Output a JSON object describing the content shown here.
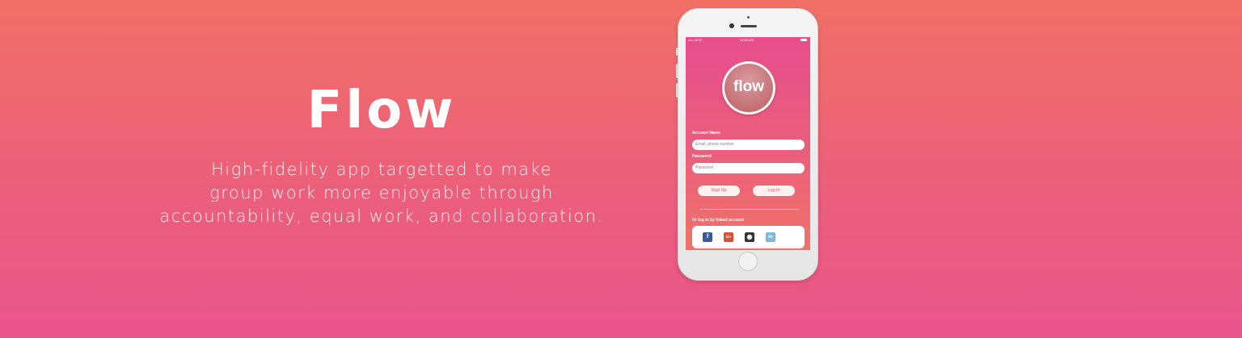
{
  "hero": {
    "title": "Flow",
    "description_lines": [
      "High-fidelity app targetted to make",
      "group work more enjoyable  through",
      "accountability, equal work, and collaboration."
    ]
  },
  "phone_screen": {
    "status_bar": {
      "carrier": "••••• AT&T",
      "time": "12:00 AM"
    },
    "logo_text": "flow",
    "account_label": "Account Name",
    "account_placeholder": "Email, phone number",
    "password_label": "Password",
    "password_placeholder": "Password",
    "signup_label": "Sign Up",
    "login_label": "Log In",
    "linked_label": "Or log in by linked account",
    "social_icons": [
      {
        "name": "facebook-icon",
        "glyph": "f",
        "color": "#3b5998"
      },
      {
        "name": "google-plus-icon",
        "glyph": "G+",
        "color": "#dd4b39"
      },
      {
        "name": "github-icon",
        "glyph": "◉",
        "color": "#333333"
      },
      {
        "name": "linkedin-icon",
        "glyph": "in",
        "color": "#7fb8db"
      }
    ]
  },
  "colors": {
    "background_top": "#f07066",
    "background_bottom": "#ea538c",
    "logo": "#c47074"
  }
}
